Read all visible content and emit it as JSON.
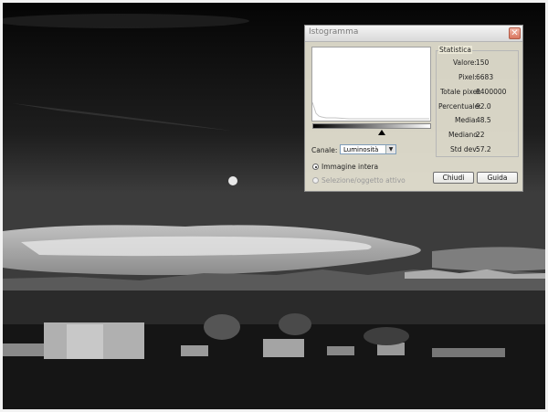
{
  "dialog": {
    "title": "Istogramma",
    "close_glyph": "✕",
    "channel_label": "Canale:",
    "channel_value": "Luminosità",
    "scope_options": [
      {
        "label": "Immagine intera",
        "selected": true,
        "enabled": true
      },
      {
        "label": "Selezione/oggetto attivo",
        "selected": false,
        "enabled": false
      }
    ],
    "stats_title": "Statistica",
    "stats": [
      {
        "label": "Valore:",
        "value": "150"
      },
      {
        "label": "Pixel:",
        "value": "6683"
      },
      {
        "label": "Totale pixel:",
        "value": "8400000"
      },
      {
        "label": "Percentuale:",
        "value": "92.0"
      },
      {
        "label": "Media:",
        "value": "48.5"
      },
      {
        "label": "Mediano:",
        "value": "22"
      },
      {
        "label": "Std dev:",
        "value": "57.2"
      }
    ],
    "buttons": {
      "close": "Chiudi",
      "help": "Guida"
    },
    "marker_level": 150
  },
  "colors": {
    "dialog_bg": "#ece9d8",
    "close_button": "#d9765f"
  },
  "icons": {
    "close": "close-icon",
    "marker": "triangle-up-icon",
    "dropdown": "chevron-down-icon"
  }
}
